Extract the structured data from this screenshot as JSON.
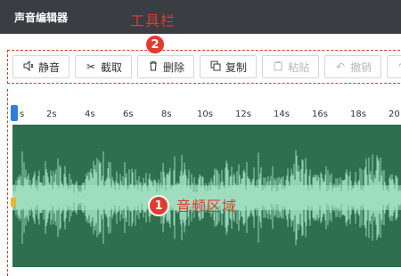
{
  "window": {
    "title": "声音编辑器"
  },
  "annotations": {
    "toolbar_label": "工具栏",
    "toolbar_badge": "2",
    "area_label": "音频区域",
    "area_badge": "1"
  },
  "toolbar": [
    {
      "label": "静音",
      "icon": "mute-icon",
      "enabled": true
    },
    {
      "label": "截取",
      "icon": "scissors-icon",
      "enabled": true
    },
    {
      "label": "删除",
      "icon": "trash-icon",
      "enabled": true
    },
    {
      "label": "复制",
      "icon": "copy-icon",
      "enabled": true
    },
    {
      "label": "粘贴",
      "icon": "paste-icon",
      "enabled": false
    },
    {
      "label": "撤销",
      "icon": "undo-icon",
      "enabled": false
    },
    {
      "label": "",
      "icon": "redo-icon",
      "enabled": false
    }
  ],
  "timeline": {
    "ticks": [
      "s",
      "2s",
      "4s",
      "6s",
      "8s",
      "10s",
      "12s",
      "14s",
      "16s",
      "18s",
      "20"
    ]
  },
  "colors": {
    "accent_red": "#e23b2e",
    "waveform_bg": "#2f6e4e",
    "waveform_fg": "#a6e6c6",
    "titlebar": "#3a3d42",
    "playhead": "#2d7ddc"
  }
}
